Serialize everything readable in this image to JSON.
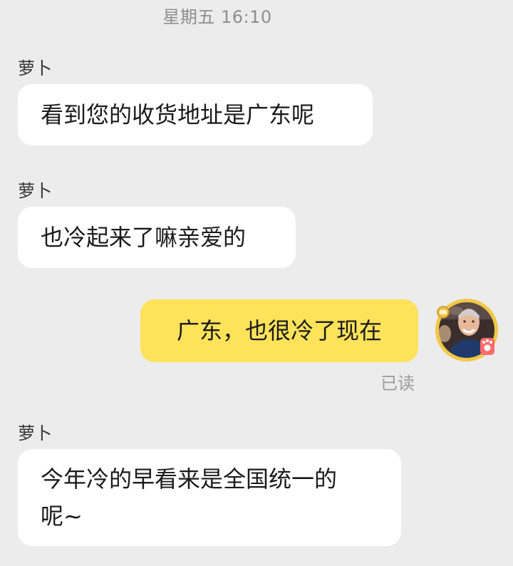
{
  "chat": {
    "timestamp": "星期五 16:10",
    "messages": [
      {
        "sender": "萝卜",
        "text": "看到您的收货地址是广东呢"
      },
      {
        "sender": "萝卜",
        "text": "也冷起来了嘛亲爱的"
      },
      {
        "text": "广东，也很冷了现在",
        "status": "已读"
      },
      {
        "sender": "萝卜",
        "line1": "今年冷的早看来是全国统一的",
        "line2": "呢~"
      }
    ]
  },
  "colors": {
    "background": "#ececec",
    "incoming_bubble": "#ffffff",
    "outgoing_bubble": "#fde25a"
  },
  "icons": {
    "avatar": "avatar-photo-with-paw-badge"
  }
}
